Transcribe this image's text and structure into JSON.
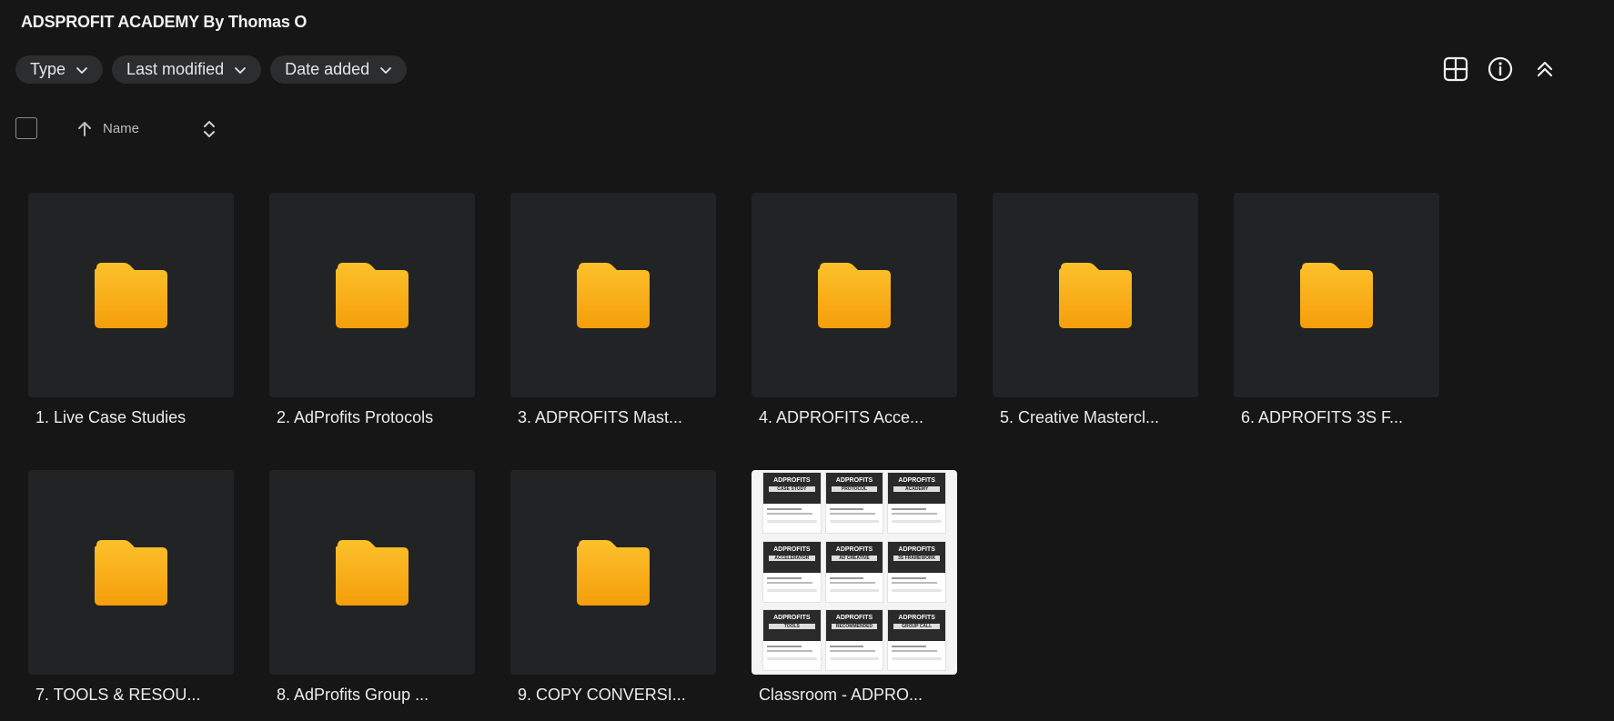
{
  "header": {
    "title": "ADSPROFIT ACADEMY By Thomas O"
  },
  "filters": [
    {
      "label": "Type"
    },
    {
      "label": "Last modified"
    },
    {
      "label": "Date added"
    }
  ],
  "toolbar": {
    "icons": [
      "grid-view-icon",
      "info-icon",
      "collapse-icon"
    ]
  },
  "sort": {
    "label": "Name",
    "direction": "ascending"
  },
  "items": [
    {
      "name": "1. Live Case Studies",
      "kind": "folder"
    },
    {
      "name": "2. AdProfits Protocols",
      "kind": "folder"
    },
    {
      "name": "3. ADPROFITS Mast...",
      "kind": "folder"
    },
    {
      "name": "4. ADPROFITS Acce...",
      "kind": "folder"
    },
    {
      "name": "5. Creative Mastercl...",
      "kind": "folder"
    },
    {
      "name": "6. ADPROFITS 3S F...",
      "kind": "folder"
    },
    {
      "name": "7. TOOLS & RESOU...",
      "kind": "folder"
    },
    {
      "name": "8. AdProfits Group ...",
      "kind": "folder"
    },
    {
      "name": "9. COPY CONVERSI...",
      "kind": "folder"
    },
    {
      "name": "Classroom - ADPRO...",
      "kind": "image"
    }
  ],
  "preview_cards": [
    {
      "title": "ADPROFITS",
      "tag": "CASE STUDY"
    },
    {
      "title": "ADPROFITS",
      "tag": "PROTOCOL"
    },
    {
      "title": "ADPROFITS",
      "tag": "ACADEMY"
    },
    {
      "title": "ADPROFITS",
      "tag": "ACCELERATOR"
    },
    {
      "title": "ADPROFITS",
      "tag": "AD CREATIVE"
    },
    {
      "title": "ADPROFITS",
      "tag": "3S FRAMEWORK"
    },
    {
      "title": "ADPROFITS",
      "tag": "TOOLS"
    },
    {
      "title": "ADPROFITS",
      "tag": "RECOMMENDED"
    },
    {
      "title": "ADPROFITS",
      "tag": "GROUP CALL"
    }
  ],
  "colors": {
    "folder_top": "#fbbf24",
    "folder_bottom": "#f59e0b",
    "background": "#161616",
    "tile": "#222324"
  }
}
